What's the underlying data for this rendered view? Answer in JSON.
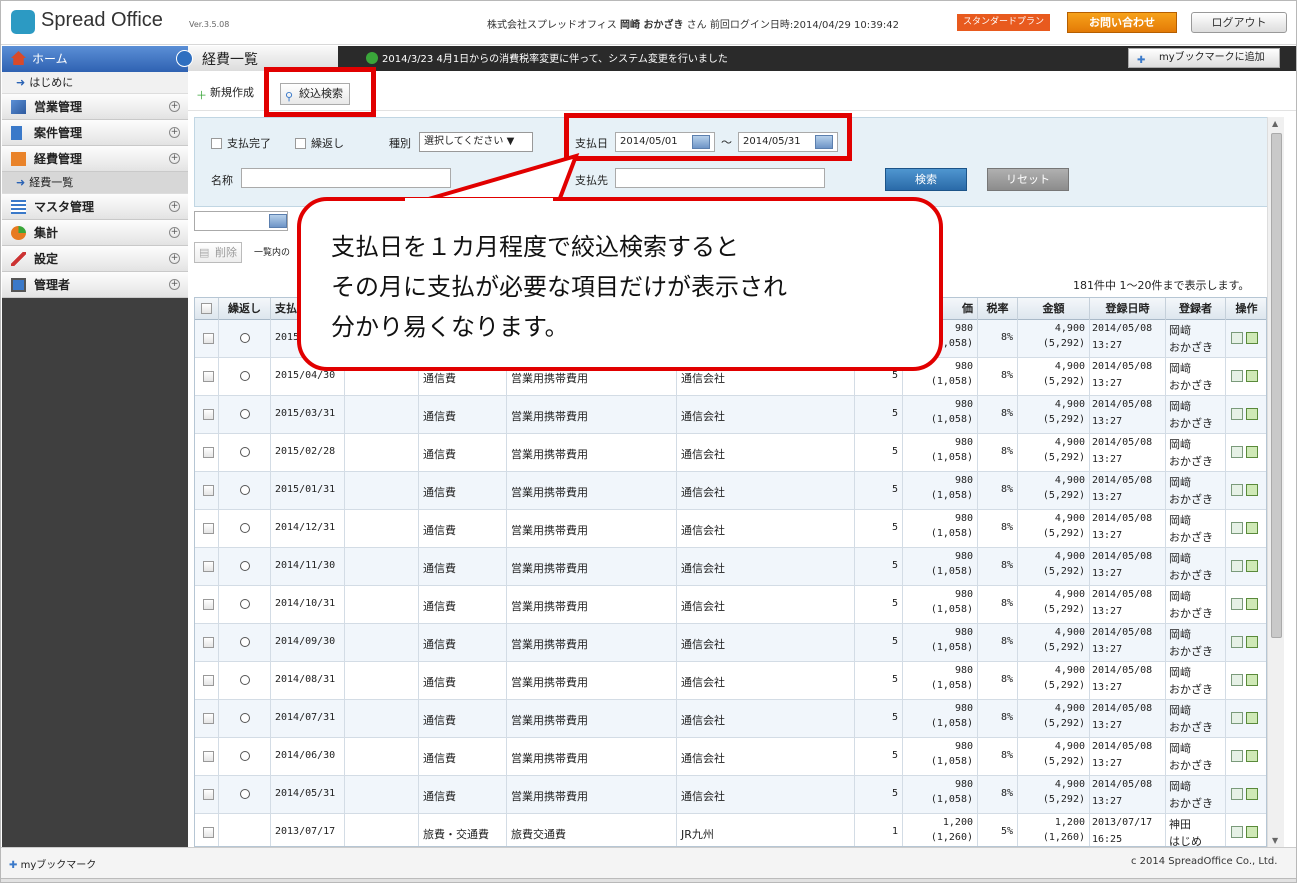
{
  "header": {
    "logo_text": "Spread Office",
    "version": "Ver.3.5.08",
    "company": "株式会社スプレッドオフィス",
    "user_name": "岡崎 おかざき",
    "user_suffix": "さん",
    "last_login_label": "前回ログイン日時:",
    "last_login_value": "2014/04/29 10:39:42",
    "plan_label": "スタンダードプラン",
    "contact_label": "お問い合わせ",
    "logout_label": "ログアウト"
  },
  "sidebar": {
    "home": "ホーム",
    "getting_started": "はじめに",
    "sales": "営業管理",
    "projects": "案件管理",
    "expenses": "経費管理",
    "expense_list": "経費一覧",
    "master": "マスタ管理",
    "aggregate": "集計",
    "settings": "設定",
    "admin": "管理者"
  },
  "titlebar": {
    "page_title": "経費一覧",
    "notice": "2014/3/23 4月1日からの消費税率変更に伴って、システム変更を行いました",
    "bookmark_add": "myブックマークに追加"
  },
  "toolbar": {
    "new_label": "新規作成",
    "filter_label": "絞込検索"
  },
  "search": {
    "paid_label": "支払完了",
    "repeat_label": "繰返し",
    "type_label": "種別",
    "type_value": "選択してください ▼",
    "pay_date_label": "支払日",
    "date_from": "2014/05/01",
    "date_sep": "〜",
    "date_to": "2014/05/31",
    "name_label": "名称",
    "payee_label": "支払先",
    "search_btn": "検索",
    "reset_btn": "リセット"
  },
  "actions": {
    "delete_label": "削除",
    "list_label": "一覧内の",
    "count_text": "181件中 1〜20件まで表示します。"
  },
  "table": {
    "headers": {
      "repeat": "繰返し",
      "pay": "支払",
      "price": "価",
      "tax": "税率",
      "amount": "金額",
      "reg_date": "登録日時",
      "registrant": "登録者",
      "ops": "操作"
    },
    "rows": [
      {
        "date": "2015",
        "type": "",
        "item": "",
        "payee": "",
        "qty": "",
        "price": "980",
        "price_tax": "(1,058)",
        "tax": "8%",
        "amount": "4,900",
        "amount_tax": "(5,292)",
        "reg_date": "2014/05/08",
        "reg_time": "13:27",
        "reg1": "岡﨑",
        "reg2": "おかざき",
        "radio": true
      },
      {
        "date": "2015/04/30",
        "type": "通信費",
        "item": "営業用携帯費用",
        "payee": "通信会社",
        "qty": "5",
        "price": "980",
        "price_tax": "(1,058)",
        "tax": "8%",
        "amount": "4,900",
        "amount_tax": "(5,292)",
        "reg_date": "2014/05/08",
        "reg_time": "13:27",
        "reg1": "岡﨑",
        "reg2": "おかざき",
        "radio": true
      },
      {
        "date": "2015/03/31",
        "type": "通信費",
        "item": "営業用携帯費用",
        "payee": "通信会社",
        "qty": "5",
        "price": "980",
        "price_tax": "(1,058)",
        "tax": "8%",
        "amount": "4,900",
        "amount_tax": "(5,292)",
        "reg_date": "2014/05/08",
        "reg_time": "13:27",
        "reg1": "岡﨑",
        "reg2": "おかざき",
        "radio": true
      },
      {
        "date": "2015/02/28",
        "type": "通信費",
        "item": "営業用携帯費用",
        "payee": "通信会社",
        "qty": "5",
        "price": "980",
        "price_tax": "(1,058)",
        "tax": "8%",
        "amount": "4,900",
        "amount_tax": "(5,292)",
        "reg_date": "2014/05/08",
        "reg_time": "13:27",
        "reg1": "岡﨑",
        "reg2": "おかざき",
        "radio": true
      },
      {
        "date": "2015/01/31",
        "type": "通信費",
        "item": "営業用携帯費用",
        "payee": "通信会社",
        "qty": "5",
        "price": "980",
        "price_tax": "(1,058)",
        "tax": "8%",
        "amount": "4,900",
        "amount_tax": "(5,292)",
        "reg_date": "2014/05/08",
        "reg_time": "13:27",
        "reg1": "岡﨑",
        "reg2": "おかざき",
        "radio": true
      },
      {
        "date": "2014/12/31",
        "type": "通信費",
        "item": "営業用携帯費用",
        "payee": "通信会社",
        "qty": "5",
        "price": "980",
        "price_tax": "(1,058)",
        "tax": "8%",
        "amount": "4,900",
        "amount_tax": "(5,292)",
        "reg_date": "2014/05/08",
        "reg_time": "13:27",
        "reg1": "岡﨑",
        "reg2": "おかざき",
        "radio": true
      },
      {
        "date": "2014/11/30",
        "type": "通信費",
        "item": "営業用携帯費用",
        "payee": "通信会社",
        "qty": "5",
        "price": "980",
        "price_tax": "(1,058)",
        "tax": "8%",
        "amount": "4,900",
        "amount_tax": "(5,292)",
        "reg_date": "2014/05/08",
        "reg_time": "13:27",
        "reg1": "岡﨑",
        "reg2": "おかざき",
        "radio": true
      },
      {
        "date": "2014/10/31",
        "type": "通信費",
        "item": "営業用携帯費用",
        "payee": "通信会社",
        "qty": "5",
        "price": "980",
        "price_tax": "(1,058)",
        "tax": "8%",
        "amount": "4,900",
        "amount_tax": "(5,292)",
        "reg_date": "2014/05/08",
        "reg_time": "13:27",
        "reg1": "岡﨑",
        "reg2": "おかざき",
        "radio": true
      },
      {
        "date": "2014/09/30",
        "type": "通信費",
        "item": "営業用携帯費用",
        "payee": "通信会社",
        "qty": "5",
        "price": "980",
        "price_tax": "(1,058)",
        "tax": "8%",
        "amount": "4,900",
        "amount_tax": "(5,292)",
        "reg_date": "2014/05/08",
        "reg_time": "13:27",
        "reg1": "岡﨑",
        "reg2": "おかざき",
        "radio": true
      },
      {
        "date": "2014/08/31",
        "type": "通信費",
        "item": "営業用携帯費用",
        "payee": "通信会社",
        "qty": "5",
        "price": "980",
        "price_tax": "(1,058)",
        "tax": "8%",
        "amount": "4,900",
        "amount_tax": "(5,292)",
        "reg_date": "2014/05/08",
        "reg_time": "13:27",
        "reg1": "岡﨑",
        "reg2": "おかざき",
        "radio": true
      },
      {
        "date": "2014/07/31",
        "type": "通信費",
        "item": "営業用携帯費用",
        "payee": "通信会社",
        "qty": "5",
        "price": "980",
        "price_tax": "(1,058)",
        "tax": "8%",
        "amount": "4,900",
        "amount_tax": "(5,292)",
        "reg_date": "2014/05/08",
        "reg_time": "13:27",
        "reg1": "岡﨑",
        "reg2": "おかざき",
        "radio": true
      },
      {
        "date": "2014/06/30",
        "type": "通信費",
        "item": "営業用携帯費用",
        "payee": "通信会社",
        "qty": "5",
        "price": "980",
        "price_tax": "(1,058)",
        "tax": "8%",
        "amount": "4,900",
        "amount_tax": "(5,292)",
        "reg_date": "2014/05/08",
        "reg_time": "13:27",
        "reg1": "岡﨑",
        "reg2": "おかざき",
        "radio": true
      },
      {
        "date": "2014/05/31",
        "type": "通信費",
        "item": "営業用携帯費用",
        "payee": "通信会社",
        "qty": "5",
        "price": "980",
        "price_tax": "(1,058)",
        "tax": "8%",
        "amount": "4,900",
        "amount_tax": "(5,292)",
        "reg_date": "2014/05/08",
        "reg_time": "13:27",
        "reg1": "岡﨑",
        "reg2": "おかざき",
        "radio": true
      },
      {
        "date": "2013/07/17",
        "type": "旅費・交通費",
        "item": "旅費交通費",
        "payee": "JR九州",
        "qty": "1",
        "price": "1,200",
        "price_tax": "(1,260)",
        "tax": "5%",
        "amount": "1,200",
        "amount_tax": "(1,260)",
        "reg_date": "2013/07/17",
        "reg_time": "16:25",
        "reg1": "神田",
        "reg2": "はじめ",
        "radio": false
      }
    ]
  },
  "callout": {
    "line1": "支払日を１カ月程度で絞込検索すると",
    "line2": "その月に支払が必要な項目だけが表示され",
    "line3": "分かり易くなります。"
  },
  "footer": {
    "bookmark": "myブックマーク",
    "copyright": "c 2014 SpreadOffice Co., Ltd."
  },
  "colors": {
    "highlight": "#e10000",
    "nav_blue": "#2f62b2",
    "search_bg": "#e7f1f7"
  }
}
